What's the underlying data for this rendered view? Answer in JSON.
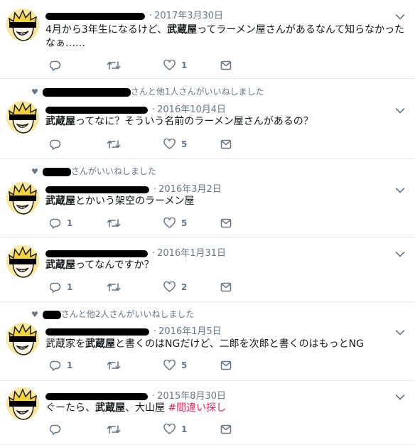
{
  "tweets": [
    {
      "date": "2017年3月30日",
      "context": null,
      "body": [
        {
          "t": "4月から3年生になるけど、"
        },
        {
          "t": "武蔵屋",
          "b": true
        },
        {
          "t": "ってラーメン屋さんがあるなんて知らなかった"
        }
      ],
      "body2": "なぁ……",
      "counts": {
        "reply": "",
        "like": "1"
      }
    },
    {
      "date": "2016年10月4日",
      "context": "さんと他1人さんがいいねしました",
      "body": [
        {
          "t": "武蔵屋",
          "b": true
        },
        {
          "t": "ってなに？そういう名前のラーメン屋さんがあるの？"
        }
      ],
      "counts": {
        "reply": "",
        "like": "5"
      }
    },
    {
      "date": "2016年3月2日",
      "context": "さんがいいねしました",
      "body": [
        {
          "t": "武蔵屋",
          "b": true
        },
        {
          "t": "とかいう架空のラーメン屋"
        }
      ],
      "counts": {
        "reply": "1",
        "like": "5"
      }
    },
    {
      "date": "2016年1月31日",
      "context": null,
      "body": [
        {
          "t": "武蔵屋",
          "b": true
        },
        {
          "t": "ってなんですか？"
        }
      ],
      "counts": {
        "reply": "1",
        "like": "2"
      }
    },
    {
      "date": "2016年1月5日",
      "context": "さんと他2人さんがいいねしました",
      "body": [
        {
          "t": "武蔵家を"
        },
        {
          "t": "武蔵屋",
          "b": true
        },
        {
          "t": "と書くのはNGだけど、二郎を次郎と書くのはもっとNG"
        }
      ],
      "counts": {
        "reply": "1",
        "like": "5"
      }
    },
    {
      "date": "2015年8月30日",
      "context": null,
      "body": [
        {
          "t": "ぐーたら、"
        },
        {
          "t": "武蔵屋",
          "b": true
        },
        {
          "t": "、大山屋 "
        },
        {
          "t": "#間違い探し",
          "h": true
        }
      ],
      "counts": {
        "reply": "",
        "like": "1"
      }
    }
  ],
  "colors": {
    "text": "#14171a",
    "muted": "#657786",
    "hashtag": "#e0245e",
    "divider": "#e6ecf0"
  },
  "icons": {
    "reply": "reply-icon",
    "retweet": "retweet-icon",
    "like": "heart-icon",
    "dm": "envelope-icon",
    "menu": "chevron-down-icon"
  }
}
